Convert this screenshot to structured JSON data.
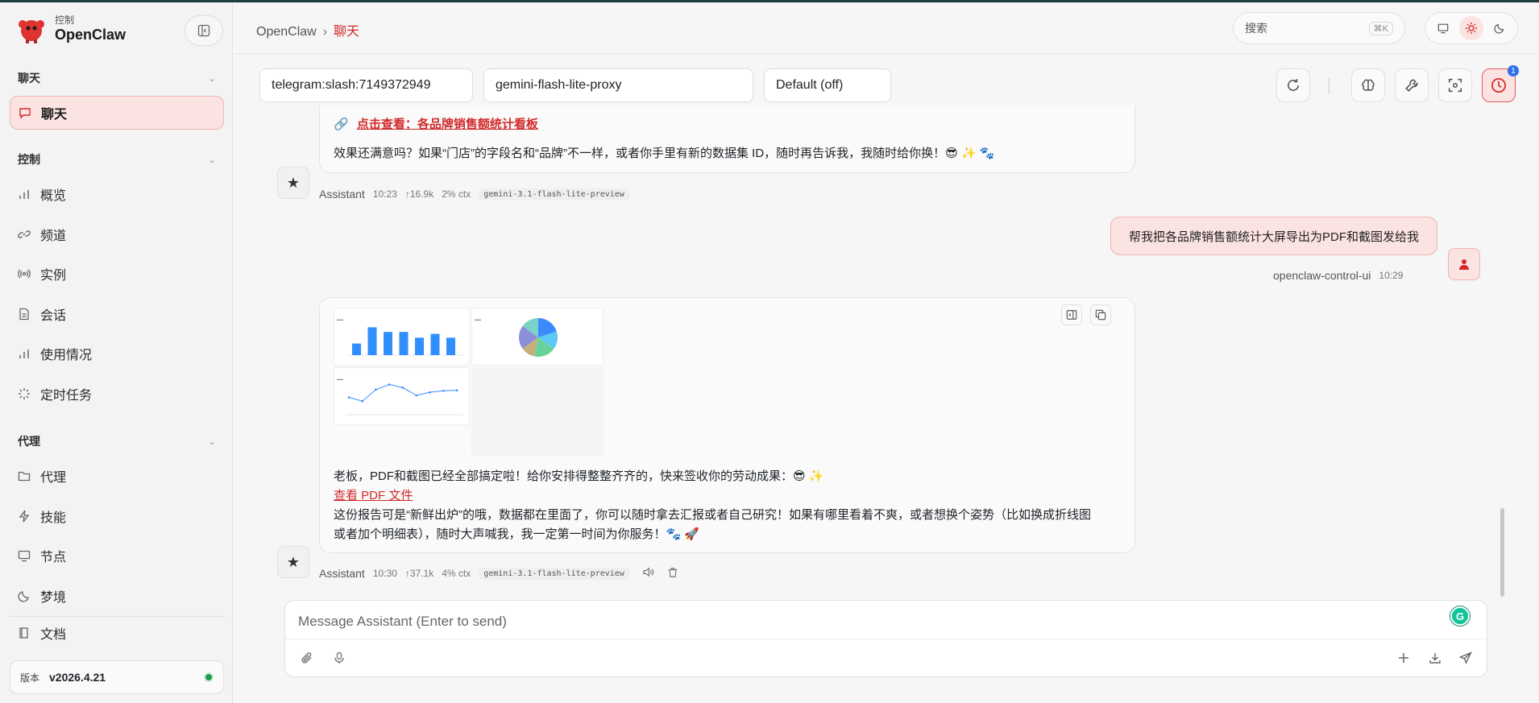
{
  "brand": {
    "subtitle": "控制",
    "name": "OpenClaw"
  },
  "sidebar": {
    "sections": [
      {
        "label": "聊天"
      },
      {
        "label": "控制"
      },
      {
        "label": "代理"
      }
    ],
    "items": [
      {
        "label": "聊天",
        "icon": "chat-bubble-icon",
        "active": true
      },
      {
        "label": "概览",
        "icon": "bar-chart-icon"
      },
      {
        "label": "频道",
        "icon": "link-icon"
      },
      {
        "label": "实例",
        "icon": "broadcast-icon"
      },
      {
        "label": "会话",
        "icon": "document-icon"
      },
      {
        "label": "使用情况",
        "icon": "bar-chart-icon"
      },
      {
        "label": "定时任务",
        "icon": "loader-icon"
      },
      {
        "label": "代理",
        "icon": "folder-icon"
      },
      {
        "label": "技能",
        "icon": "bolt-icon"
      },
      {
        "label": "节点",
        "icon": "monitor-icon"
      },
      {
        "label": "梦境",
        "icon": "moon-icon"
      },
      {
        "label": "文档",
        "icon": "book-icon"
      }
    ],
    "version_label": "版本",
    "version_value": "v2026.4.21"
  },
  "topbar": {
    "breadcrumb_root": "OpenClaw",
    "breadcrumb_sep": "›",
    "breadcrumb_current": "聊天",
    "search_placeholder": "搜索",
    "search_shortcut": "⌘K"
  },
  "session": {
    "channel": "telegram:slash:7149372949",
    "model": "gemini-flash-lite-proxy",
    "thinking": "Default (off)",
    "badge_count": "1"
  },
  "messages": {
    "m1": {
      "link_text": "点击查看：各品牌销售额统计看板",
      "text": "效果还满意吗？如果“门店”的字段名和“品牌”不一样，或者你手里有新的数据集 ID，随时再告诉我，我随时给你换！😎 ✨ 🐾",
      "author": "Assistant",
      "time": "10:23",
      "tokens": "↑16.9k",
      "ctx": "2% ctx",
      "model": "gemini-3.1-flash-lite-preview"
    },
    "user": {
      "text": "帮我把各品牌销售额统计大屏导出为PDF和截图发给我",
      "author": "openclaw-control-ui",
      "time": "10:29"
    },
    "m2": {
      "line1": "老板，PDF和截图已经全部搞定啦！给你安排得整整齐齐的，快来签收你的劳动成果：😎 ✨",
      "link_text": "查看 PDF 文件",
      "line2": "这份报告可是“新鲜出炉”的哦，数据都在里面了，你可以随时拿去汇报或者自己研究！如果有哪里看着不爽，或者想换个姿势（比如换成折线图",
      "line3": "或者加个明细表），随时大声喊我，我一定第一时间为你服务！🐾 🚀",
      "author": "Assistant",
      "time": "10:30",
      "tokens": "↑37.1k",
      "ctx": "4% ctx",
      "model": "gemini-3.1-flash-lite-preview"
    }
  },
  "thumbs": {
    "bars": [
      0.3,
      0.72,
      0.6,
      0.6,
      0.45,
      0.55,
      0.45
    ],
    "line": [
      0.45,
      0.35,
      0.65,
      0.78,
      0.7,
      0.5,
      0.58,
      0.62,
      0.63
    ],
    "pie": [
      0.2,
      0.15,
      0.18,
      0.12,
      0.2,
      0.15
    ],
    "pie_colors": [
      "#3b8bff",
      "#5bc8f5",
      "#66d49a",
      "#c4b07a",
      "#8a8fd8",
      "#7ad3c8"
    ]
  },
  "composer": {
    "placeholder": "Message Assistant (Enter to send)"
  },
  "colors": {
    "accent": "#d22a2a",
    "accent_bg": "#fbe3e2",
    "status_ok": "#1f9d4c"
  }
}
